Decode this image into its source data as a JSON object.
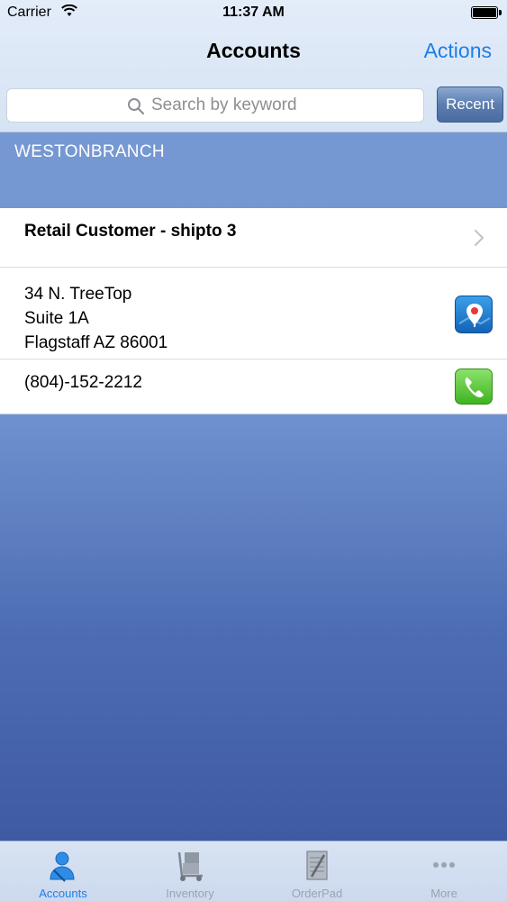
{
  "status_bar": {
    "carrier": "Carrier",
    "time": "11:37 AM"
  },
  "nav": {
    "title": "Accounts",
    "actions_label": "Actions"
  },
  "search": {
    "placeholder": "Search by keyword",
    "recent_label": "Recent"
  },
  "branch": {
    "name": "WESTONBRANCH"
  },
  "account": {
    "name": "Retail Customer - shipto 3",
    "address_line1": "34 N. TreeTop",
    "address_line2": "Suite 1A",
    "address_line3": "Flagstaff AZ 86001",
    "phone": "(804)-152-2212"
  },
  "tabs": [
    {
      "label": "Accounts",
      "icon": "person-icon",
      "active": true
    },
    {
      "label": "Inventory",
      "icon": "hand-truck-icon",
      "active": false
    },
    {
      "label": "OrderPad",
      "icon": "notepad-icon",
      "active": false
    },
    {
      "label": "More",
      "icon": "more-dots-icon",
      "active": false
    }
  ],
  "colors": {
    "accent": "#1c7ee8",
    "tab_inactive": "#9aa3b0",
    "background_top": "#7a9cd4",
    "background_bottom": "#3a559e"
  }
}
